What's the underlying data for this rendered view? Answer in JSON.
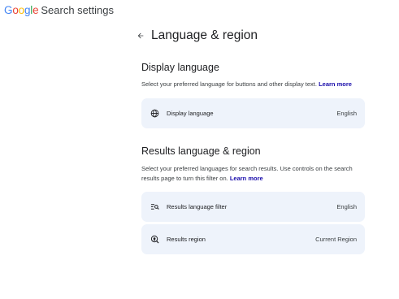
{
  "topbar": {
    "logo_letters": [
      "G",
      "o",
      "o",
      "g",
      "l",
      "e"
    ],
    "logo_colors": [
      "#4285f4",
      "#ea4335",
      "#fbbc05",
      "#4285f4",
      "#34a853",
      "#ea4335"
    ],
    "title": "Search settings"
  },
  "header": {
    "back_icon": "arrow-left-icon",
    "title": "Language & region"
  },
  "display_language": {
    "heading": "Display language",
    "description": "Select your preferred language for buttons and other display text.",
    "learn_more": "Learn more",
    "item": {
      "icon": "globe-icon",
      "label": "Display language",
      "value": "English"
    }
  },
  "results_language": {
    "heading": "Results language & region",
    "description": "Select your preferred languages for search results. Use controls on the search results page to turn this filter on.",
    "learn_more": "Learn more",
    "items": [
      {
        "icon": "filter-search-icon",
        "label": "Results language filter",
        "value": "English"
      },
      {
        "icon": "location-search-icon",
        "label": "Results region",
        "value": "Current Region"
      }
    ]
  },
  "colors": {
    "card_background": "#eef3fb",
    "link": "#1a0dab"
  }
}
